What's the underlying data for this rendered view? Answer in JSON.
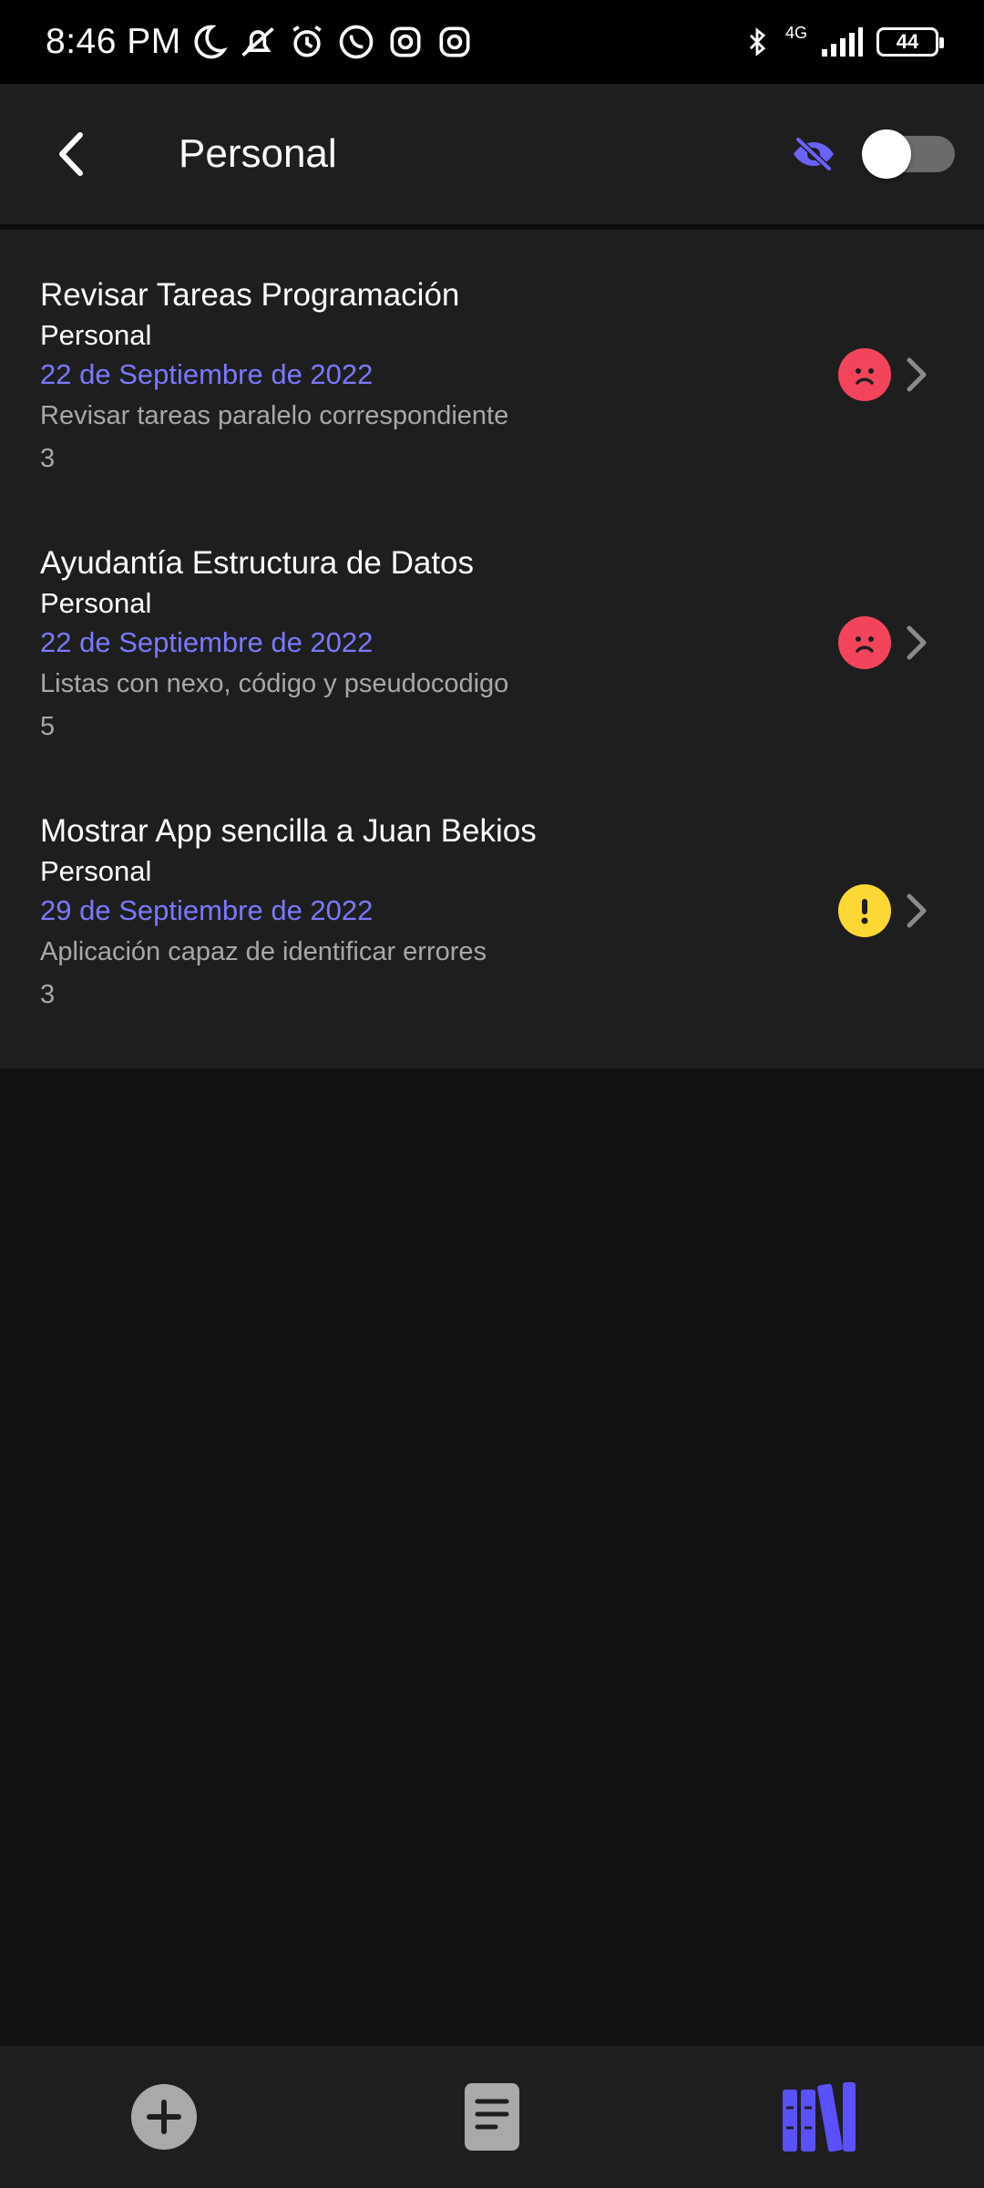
{
  "status_bar": {
    "time": "8:46 PM",
    "network": "4G",
    "battery": "44",
    "icons": [
      "moon-icon",
      "mute-icon",
      "alarm-icon",
      "whatsapp-icon",
      "instagram-icon",
      "instagram-icon",
      "bluetooth-icon",
      "signal-icon",
      "battery-icon"
    ]
  },
  "appbar": {
    "title": "Personal",
    "back_icon": "back-arrow-icon",
    "visibility_icon": "eye-off-icon",
    "toggle_on": false,
    "accent_color": "#6a62ff"
  },
  "tasks": [
    {
      "title": "Revisar Tareas Programación",
      "category": "Personal",
      "date": "22 de Septiembre de 2022",
      "description": "Revisar tareas paralelo correspondiente",
      "number": "3",
      "status_icon": "sad-face-icon",
      "status_color": "#f2455c"
    },
    {
      "title": "Ayudantía Estructura de Datos",
      "category": "Personal",
      "date": "22 de Septiembre de 2022",
      "description": "Listas con nexo, código y pseudocodigo",
      "number": "5",
      "status_icon": "sad-face-icon",
      "status_color": "#f2455c"
    },
    {
      "title": "Mostrar App sencilla a Juan Bekios",
      "category": "Personal",
      "date": "29 de Septiembre de 2022",
      "description": "Aplicación capaz de identificar errores",
      "number": "3",
      "status_icon": "warning-icon",
      "status_color": "#fdd835"
    }
  ],
  "bottom_nav": {
    "items": [
      "add-icon",
      "notes-icon",
      "library-icon"
    ],
    "active": "library-icon"
  }
}
